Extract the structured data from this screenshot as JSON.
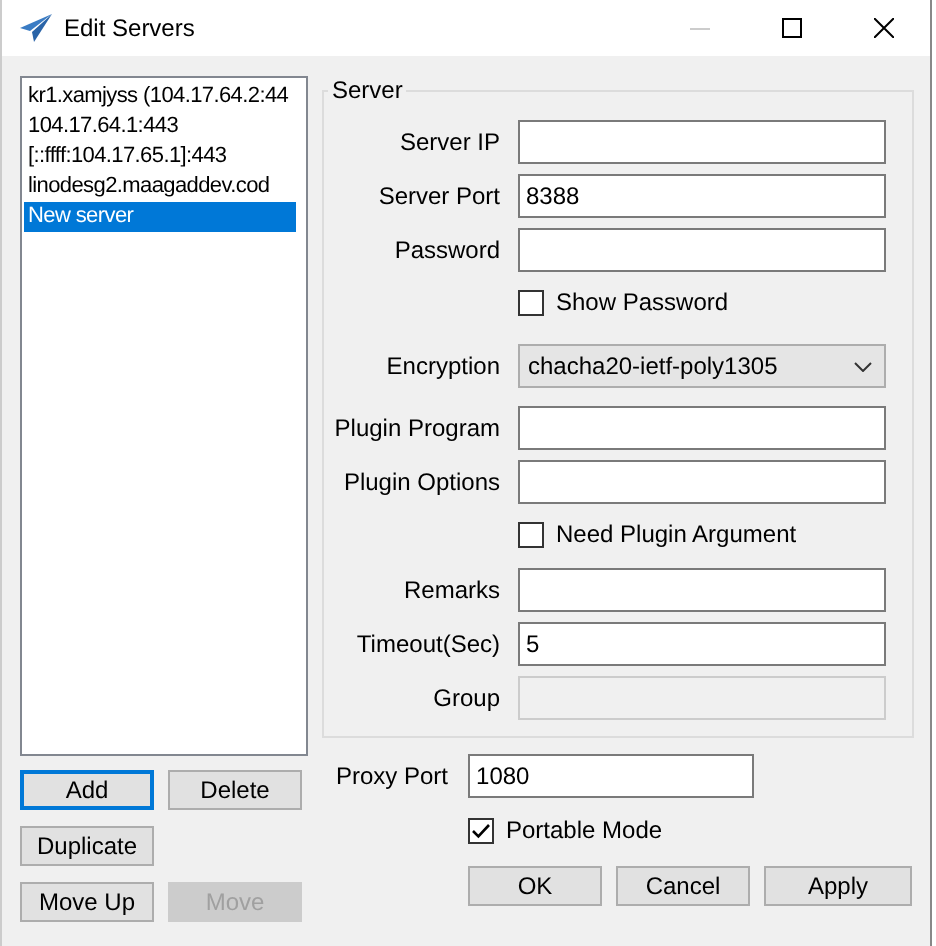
{
  "window": {
    "title": "Edit Servers"
  },
  "servers": [
    {
      "label": "kr1.xamjyss (104.17.64.2:44",
      "selected": false
    },
    {
      "label": "104.17.64.1:443",
      "selected": false
    },
    {
      "label": "[::ffff:104.17.65.1]:443",
      "selected": false
    },
    {
      "label": "linodesg2.maagaddev.cod",
      "selected": false
    },
    {
      "label": "New server",
      "selected": true
    }
  ],
  "list_buttons": [
    {
      "label": "Add",
      "disabled": false,
      "focused": true
    },
    {
      "label": "Delete",
      "disabled": false,
      "focused": false
    },
    {
      "label": "Duplicate",
      "disabled": false,
      "focused": false
    },
    {
      "label": "Move Up",
      "disabled": false,
      "focused": false
    },
    {
      "label": "Move",
      "disabled": true,
      "focused": false
    }
  ],
  "server_group": {
    "title": "Server",
    "fields": [
      {
        "kind": "text",
        "label": "Server IP",
        "disabled": false
      },
      {
        "kind": "text",
        "label": "Server Port",
        "value": "8388",
        "disabled": false
      },
      {
        "kind": "text",
        "label": "Password",
        "disabled": false
      },
      {
        "kind": "checkbox",
        "label": "Show Password",
        "checked": false
      },
      {
        "kind": "select",
        "label": "Encryption",
        "value": "chacha20-ietf-poly1305"
      },
      {
        "kind": "text",
        "label": "Plugin Program",
        "disabled": false
      },
      {
        "kind": "text",
        "label": "Plugin Options",
        "disabled": false
      },
      {
        "kind": "checkbox",
        "label": "Need Plugin Argument",
        "checked": false
      },
      {
        "kind": "text",
        "label": "Remarks",
        "disabled": false
      },
      {
        "kind": "text",
        "label": "Timeout(Sec)",
        "value": "5",
        "disabled": false
      },
      {
        "kind": "text",
        "label": "Group",
        "disabled": true
      }
    ]
  },
  "proxy_port": {
    "label": "Proxy Port",
    "value": "1080"
  },
  "portable_mode": {
    "label": "Portable Mode",
    "checked": true
  },
  "dialog_buttons": [
    "OK",
    "Cancel",
    "Apply"
  ]
}
